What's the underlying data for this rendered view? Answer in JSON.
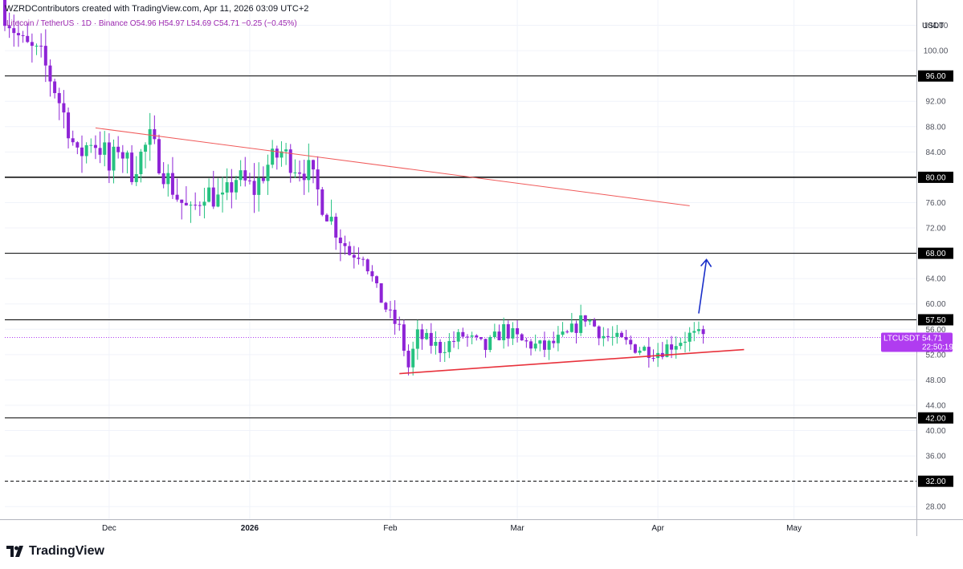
{
  "header": {
    "caption": "WZRDContributors created with TradingView.com, Apr 11, 2026 03:09 UTC+2",
    "symbol_line": "Litecoin / TetherUS · 1D · Binance",
    "open": "O54.96",
    "high": "H54.97",
    "low": "L54.69",
    "close": "C54.71",
    "change": "−0.25 (−0.45%)"
  },
  "price_scale": {
    "currency": "USDT",
    "ticks": [
      "28.00",
      "32.00",
      "36.00",
      "40.00",
      "44.00",
      "48.00",
      "52.00",
      "56.00",
      "60.00",
      "64.00",
      "68.00",
      "72.00",
      "76.00",
      "80.00",
      "84.00",
      "88.00",
      "92.00",
      "96.00",
      "100.00",
      "104.00"
    ],
    "current_label": "LTCUSDT",
    "current_value": "54.71",
    "countdown": "22:50:19"
  },
  "colors": {
    "bull": "#26c281",
    "bear": "#8e24d6",
    "trendline": "#f05a5a",
    "support": "#e8323c",
    "arrow": "#1a2fc9",
    "hline": "#000000",
    "current_price": "#b03cf0"
  },
  "logo": {
    "text": "TradingView"
  },
  "chart_data": {
    "type": "candlestick",
    "symbol": "LTCUSDT",
    "timeframe": "1D",
    "ylim": [
      26,
      108
    ],
    "grid": true,
    "x_ticks": [
      {
        "label": "Dec",
        "date": "2025-12-01"
      },
      {
        "label": "2026",
        "date": "2026-01-01"
      },
      {
        "label": "Feb",
        "date": "2026-02-01"
      },
      {
        "label": "Mar",
        "date": "2026-03-01"
      },
      {
        "label": "Apr",
        "date": "2026-04-01"
      },
      {
        "label": "May",
        "date": "2026-05-01"
      }
    ],
    "x_range": [
      "2025-11-08",
      "2026-05-28"
    ],
    "horizontal_levels": [
      {
        "value": 96.0,
        "label": "96.00",
        "style": "solid"
      },
      {
        "value": 80.0,
        "label": "80.00",
        "style": "solid-bold"
      },
      {
        "value": 68.0,
        "label": "68.00",
        "style": "solid"
      },
      {
        "value": 57.5,
        "label": "57.50",
        "style": "solid"
      },
      {
        "value": 42.0,
        "label": "42.00",
        "style": "solid"
      },
      {
        "value": 32.0,
        "label": "32.00",
        "style": "dashed"
      }
    ],
    "trendlines": [
      {
        "name": "resistance",
        "from": {
          "date": "2025-11-28",
          "value": 87.8
        },
        "to": {
          "date": "2026-04-08",
          "value": 75.5
        }
      },
      {
        "name": "support",
        "from": {
          "date": "2026-02-03",
          "value": 49.0
        },
        "to": {
          "date": "2026-04-20",
          "value": 52.8
        }
      }
    ],
    "arrow": {
      "from": {
        "date": "2026-04-10",
        "value": 58.5
      },
      "to": {
        "date": "2026-04-11",
        "value": 67.0
      }
    },
    "current_price": 54.71,
    "closes": [
      {
        "date": "2025-11-08",
        "close": 106.0
      },
      {
        "date": "2025-11-12",
        "close": 101.0
      },
      {
        "date": "2025-11-16",
        "close": 99.0
      },
      {
        "date": "2025-11-19",
        "close": 94.0
      },
      {
        "date": "2025-11-22",
        "close": 88.0
      },
      {
        "date": "2025-11-24",
        "close": 83.0
      },
      {
        "date": "2025-11-27",
        "close": 86.0
      },
      {
        "date": "2025-11-30",
        "close": 84.0
      },
      {
        "date": "2025-12-01",
        "close": 81.0
      },
      {
        "date": "2025-12-03",
        "close": 85.0
      },
      {
        "date": "2025-12-06",
        "close": 81.0
      },
      {
        "date": "2025-12-10",
        "close": 86.0
      },
      {
        "date": "2025-12-13",
        "close": 81.0
      },
      {
        "date": "2025-12-16",
        "close": 77.0
      },
      {
        "date": "2025-12-19",
        "close": 74.0
      },
      {
        "date": "2025-12-22",
        "close": 78.0
      },
      {
        "date": "2025-12-26",
        "close": 76.0
      },
      {
        "date": "2025-12-29",
        "close": 80.0
      },
      {
        "date": "2026-01-02",
        "close": 78.0
      },
      {
        "date": "2026-01-05",
        "close": 82.0
      },
      {
        "date": "2026-01-08",
        "close": 84.0
      },
      {
        "date": "2026-01-11",
        "close": 82.0
      },
      {
        "date": "2026-01-14",
        "close": 81.0
      },
      {
        "date": "2026-01-17",
        "close": 76.0
      },
      {
        "date": "2026-01-20",
        "close": 72.0
      },
      {
        "date": "2026-01-23",
        "close": 68.0
      },
      {
        "date": "2026-01-26",
        "close": 68.0
      },
      {
        "date": "2026-01-29",
        "close": 62.0
      },
      {
        "date": "2026-02-01",
        "close": 58.0
      },
      {
        "date": "2026-02-03",
        "close": 56.0
      },
      {
        "date": "2026-02-05",
        "close": 50.0
      },
      {
        "date": "2026-02-07",
        "close": 55.0
      },
      {
        "date": "2026-02-12",
        "close": 53.0
      },
      {
        "date": "2026-02-17",
        "close": 55.0
      },
      {
        "date": "2026-02-22",
        "close": 53.0
      },
      {
        "date": "2026-02-26",
        "close": 56.0
      },
      {
        "date": "2026-03-02",
        "close": 54.0
      },
      {
        "date": "2026-03-07",
        "close": 53.0
      },
      {
        "date": "2026-03-12",
        "close": 55.0
      },
      {
        "date": "2026-03-16",
        "close": 58.0
      },
      {
        "date": "2026-03-20",
        "close": 55.0
      },
      {
        "date": "2026-03-24",
        "close": 54.0
      },
      {
        "date": "2026-03-28",
        "close": 53.0
      },
      {
        "date": "2026-04-01",
        "close": 52.5
      },
      {
        "date": "2026-04-05",
        "close": 54.0
      },
      {
        "date": "2026-04-08",
        "close": 55.0
      },
      {
        "date": "2026-04-11",
        "close": 54.71
      }
    ]
  }
}
